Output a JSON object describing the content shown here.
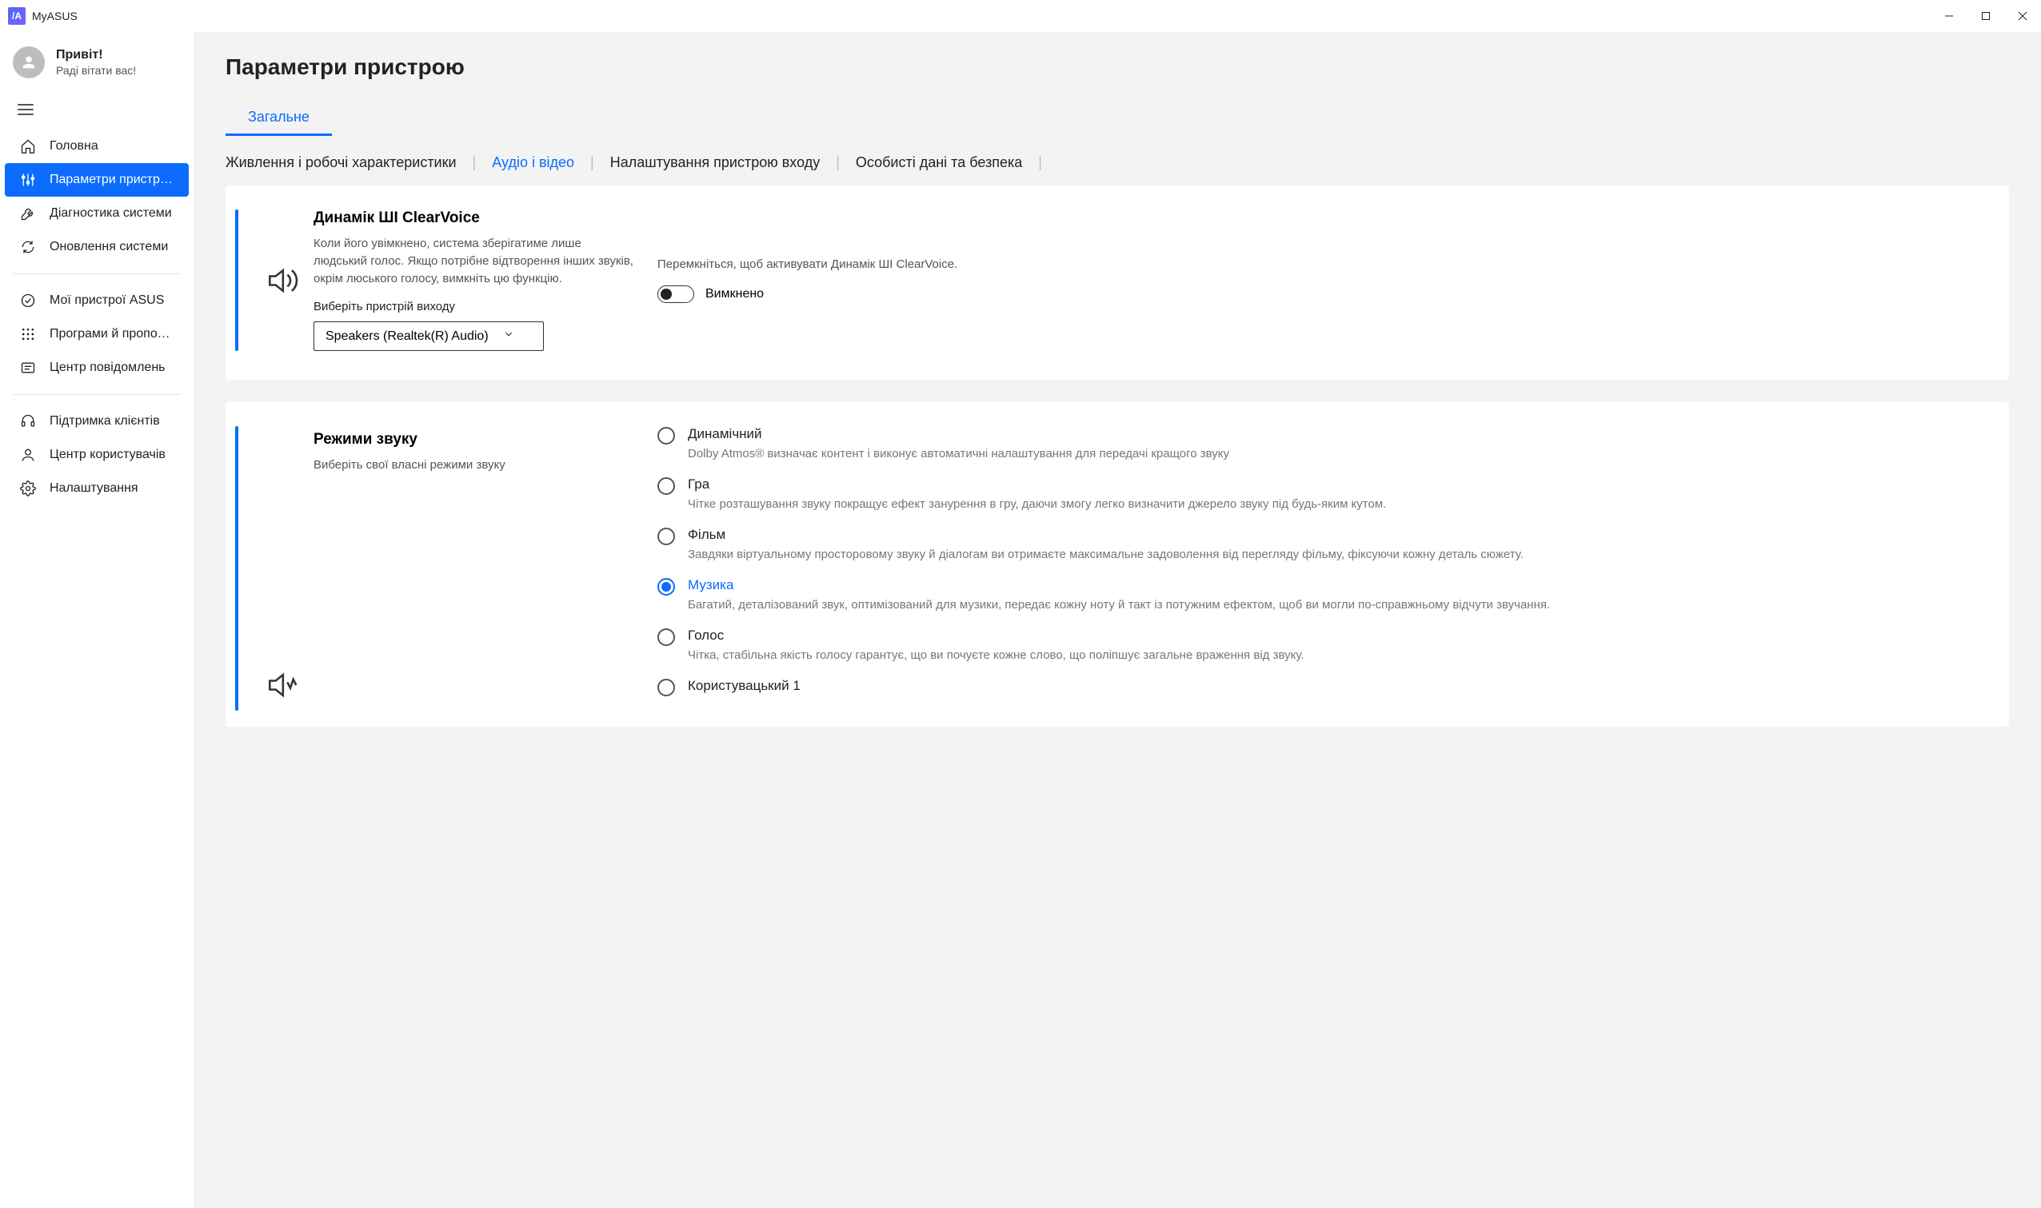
{
  "window": {
    "title": "MyASUS"
  },
  "profile": {
    "greeting": "Привіт!",
    "welcome": "Раді вітати вас!"
  },
  "sidebar": {
    "items": [
      {
        "label": "Головна"
      },
      {
        "label": "Параметри пристрою"
      },
      {
        "label": "Діагностика системи"
      },
      {
        "label": "Оновлення системи"
      },
      {
        "label": "Мої пристрої ASUS"
      },
      {
        "label": "Програми й пропозиції від..."
      },
      {
        "label": "Центр повідомлень"
      },
      {
        "label": "Підтримка клієнтів"
      },
      {
        "label": "Центр користувачів"
      },
      {
        "label": "Налаштування"
      }
    ]
  },
  "page": {
    "title": "Параметри пристрою"
  },
  "tabs": {
    "general": "Загальне"
  },
  "subtabs": {
    "power": "Живлення і робочі характеристики",
    "audio": "Аудіо і відео",
    "input": "Налаштування пристрою входу",
    "privacy": "Особисті дані та безпека"
  },
  "clearvoice": {
    "title": "Динамік ШІ ClearVoice",
    "desc": "Коли його увімкнено, система зберігатиме лише людський голос. Якщо потрібне відтворення інших звуків, окрім люського голосу, вимкніть цю функцію.",
    "select_label": "Виберіть пристрій виходу",
    "selected": "Speakers (Realtek(R) Audio)",
    "hint": "Перемкніться, щоб активувати Динамік ШІ ClearVoice.",
    "toggle_state": "Вимкнено"
  },
  "soundmodes": {
    "title": "Режими звуку",
    "desc": "Виберіть свої власні режими звуку",
    "options": [
      {
        "title": "Динамічний",
        "desc": "Dolby Atmos® визначає контент і виконує автоматичні налаштування для передачі кращого звуку",
        "selected": false
      },
      {
        "title": "Гра",
        "desc": "Чітке розташування звуку покращує ефект занурення в гру, даючи змогу легко визначити джерело звуку під будь-яким кутом.",
        "selected": false
      },
      {
        "title": "Фільм",
        "desc": "Завдяки віртуальному просторовому звуку й діалогам ви отримаєте максимальне задоволення від перегляду фільму, фіксуючи кожну деталь сюжету.",
        "selected": false
      },
      {
        "title": "Музика",
        "desc": "Багатий, деталізований звук, оптимізований для музики, передає кожну ноту й такт із потужним ефектом, щоб ви могли по-справжньому відчути звучання.",
        "selected": true
      },
      {
        "title": "Голос",
        "desc": "Чітка, стабільна якість голосу гарантує, що ви почуєте кожне слово, що поліпшує загальне враження від звуку.",
        "selected": false
      },
      {
        "title": "Користувацький 1",
        "desc": "",
        "selected": false
      }
    ]
  }
}
